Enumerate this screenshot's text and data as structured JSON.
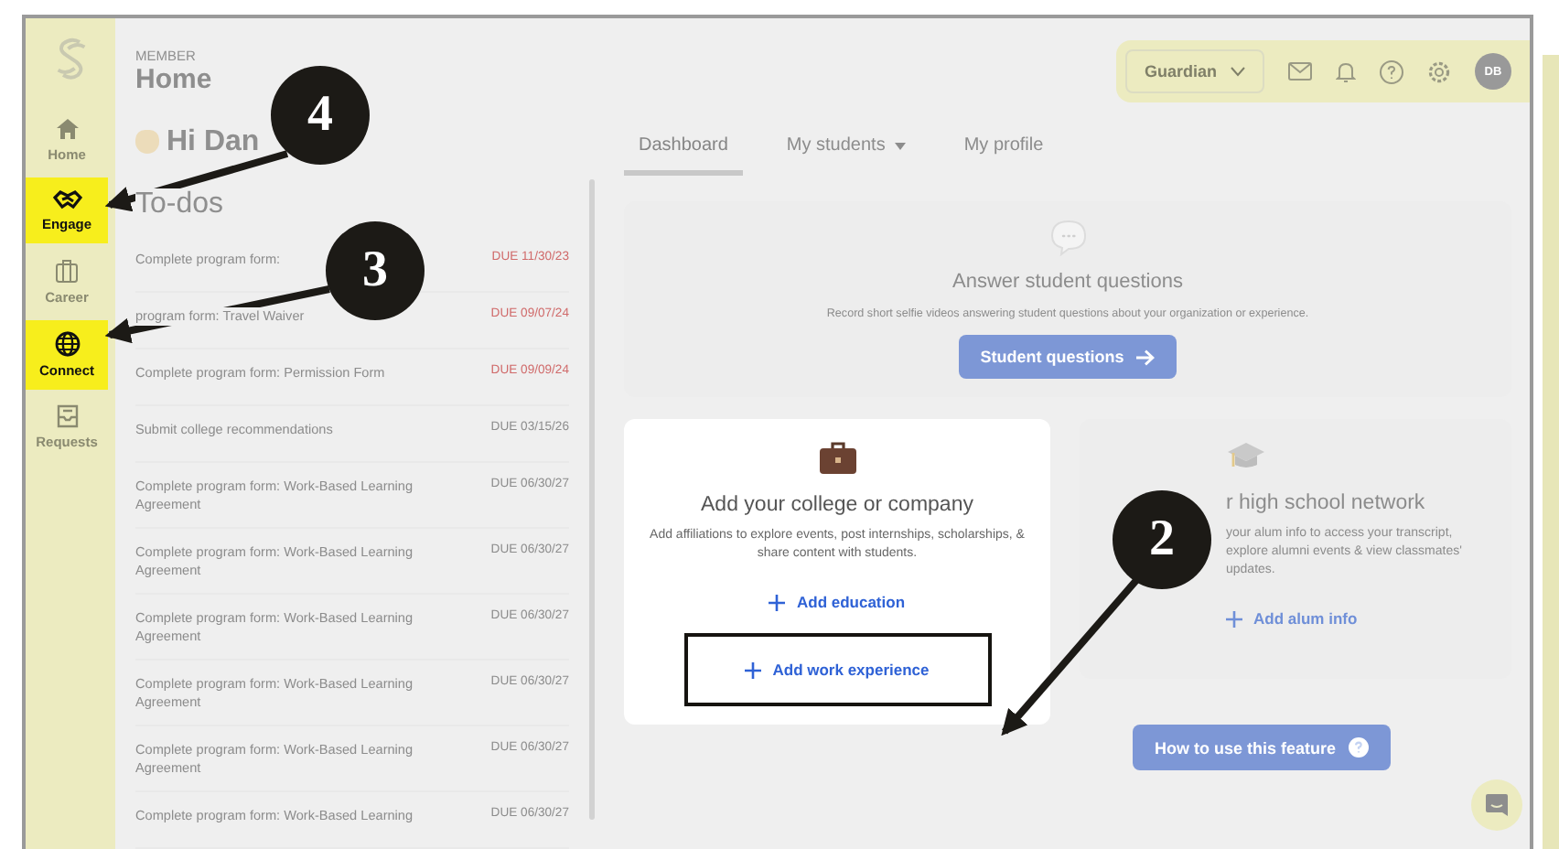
{
  "sidebar": {
    "items": [
      {
        "label": "Home",
        "highlighted": false
      },
      {
        "label": "Engage",
        "highlighted": true
      },
      {
        "label": "Career",
        "highlighted": false
      },
      {
        "label": "Connect",
        "highlighted": true
      },
      {
        "label": "Requests",
        "highlighted": false
      }
    ]
  },
  "header": {
    "eyebrow": "MEMBER",
    "title": "Home"
  },
  "toolbar": {
    "role": "Guardian",
    "avatar": "DB"
  },
  "greeting": "Hi Dan",
  "todos": {
    "title": "To-dos",
    "items": [
      {
        "text": "Complete program form:",
        "due": "DUE 11/30/23",
        "overdue": true
      },
      {
        "text": "program form: Travel Waiver",
        "due": "DUE 09/07/24",
        "overdue": true
      },
      {
        "text": "Complete program form: Permission Form",
        "due": "DUE 09/09/24",
        "overdue": true
      },
      {
        "text": "Submit college recommendations",
        "due": "DUE 03/15/26",
        "overdue": false
      },
      {
        "text": "Complete program form: Work-Based Learning Agreement",
        "due": "DUE 06/30/27",
        "overdue": false
      },
      {
        "text": "Complete program form: Work-Based Learning Agreement",
        "due": "DUE 06/30/27",
        "overdue": false
      },
      {
        "text": "Complete program form: Work-Based Learning Agreement",
        "due": "DUE 06/30/27",
        "overdue": false
      },
      {
        "text": "Complete program form: Work-Based Learning Agreement",
        "due": "DUE 06/30/27",
        "overdue": false
      },
      {
        "text": "Complete program form: Work-Based Learning Agreement",
        "due": "DUE 06/30/27",
        "overdue": false
      },
      {
        "text": "Complete program form: Work-Based Learning",
        "due": "DUE 06/30/27",
        "overdue": false
      }
    ]
  },
  "tabs": [
    {
      "label": "Dashboard",
      "selected": true,
      "dropdown": false
    },
    {
      "label": "My students",
      "selected": false,
      "dropdown": true
    },
    {
      "label": "My profile",
      "selected": false,
      "dropdown": false
    }
  ],
  "questions_card": {
    "title": "Answer student questions",
    "text": "Record short selfie videos answering student questions about your organization or experience.",
    "button": "Student questions"
  },
  "cards": [
    {
      "title": "Add your college or company",
      "text": "Add affiliations to explore events, post internships, scholarships, & share content with students.",
      "highlighted": true,
      "links": [
        {
          "label": "Add education",
          "framed": false
        },
        {
          "label": "Add work experience",
          "framed": true
        }
      ]
    },
    {
      "title": "r high school network",
      "text": "your alum info to access your transcript, explore alumni events & view classmates' updates.",
      "highlighted": false,
      "links": [
        {
          "label": "Add alum info",
          "framed": false
        }
      ]
    }
  ],
  "help_button": "How to use this feature",
  "callouts": [
    {
      "number": "4"
    },
    {
      "number": "3"
    },
    {
      "number": "2"
    }
  ]
}
